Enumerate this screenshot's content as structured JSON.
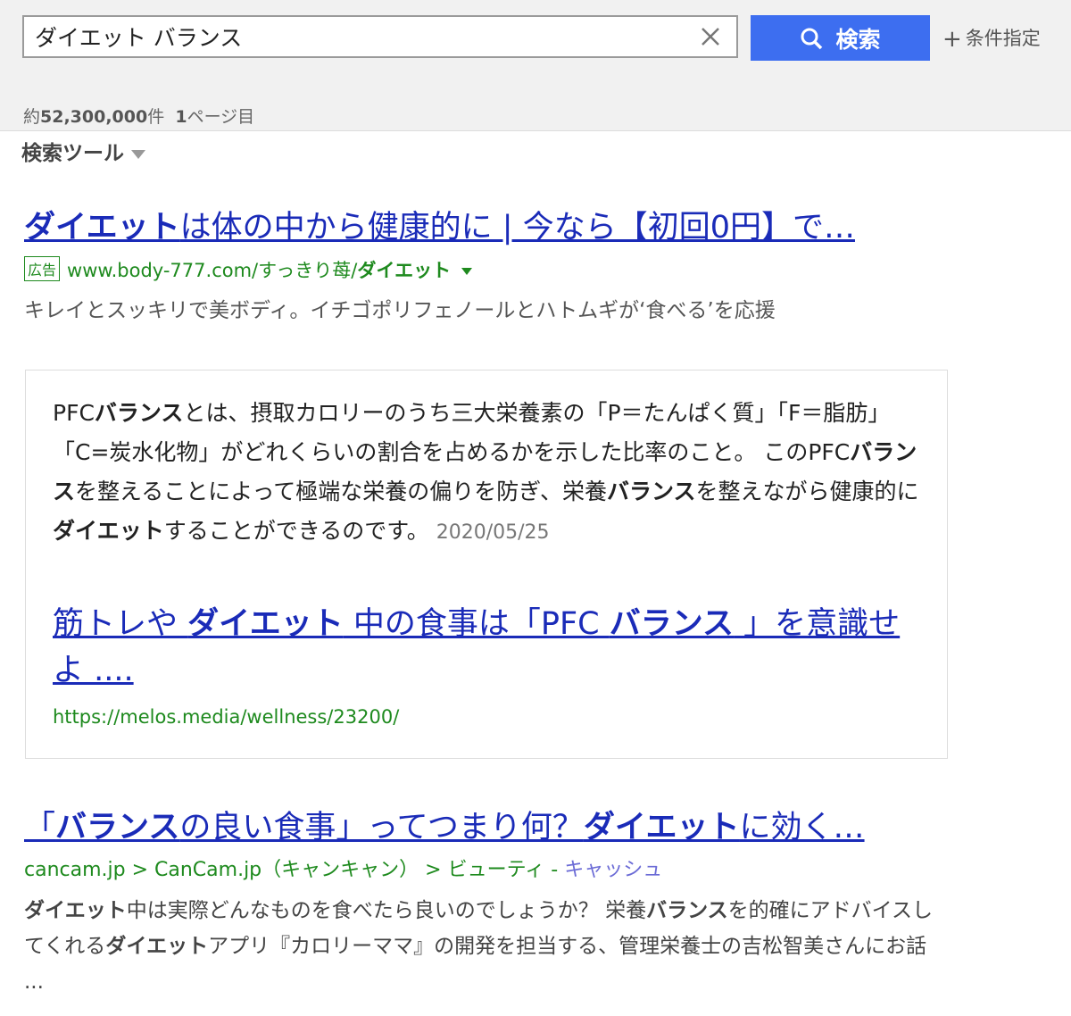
{
  "search": {
    "query": "ダイエット バランス",
    "button_label": "検索",
    "condition_label": "条件指定"
  },
  "stats": {
    "prefix": "約",
    "count": "52,300,000",
    "suffix": "件",
    "page_number": "1",
    "page_suffix": "ページ目"
  },
  "tools": {
    "label": "検索ツール"
  },
  "ad": {
    "title_parts": [
      "ダイエット",
      "は体の中から健康的に | 今なら【初回0円】で…"
    ],
    "badge": "広告",
    "url_prefix": "www.body-777.com/すっきり苺/",
    "url_bold": "ダイエット",
    "description": "キレイとスッキリで美ボディ。イチゴポリフェノールとハトムギが‘食べる’を応援"
  },
  "featured": {
    "text_parts": [
      "PFC",
      "バランス",
      "とは、摂取カロリーのうち三大栄養素の「P＝たんぱく質」「F＝脂肪」「C=炭水化物」がどれくらいの割合を占めるかを示した比率のこと。 このPFC",
      "バランス",
      "を整えることによって極端な栄養の偏りを防ぎ、栄養",
      "バランス",
      "を整えながら健康的に",
      "ダイエット",
      "することができるのです。"
    ],
    "date": "2020/05/25",
    "link_parts": [
      "筋トレや ",
      "ダイエット",
      " 中の食事は「PFC ",
      "バランス",
      " 」を意識せよ ...."
    ],
    "url": "https://melos.media/wellness/23200/"
  },
  "result2": {
    "title_parts": [
      "「",
      "バランス",
      "の良い食事」ってつまり何？",
      "ダイエット",
      "に効く…"
    ],
    "breadcrumb": "cancam.jp > CanCam.jp（キャンキャン） > ビューティ",
    "cache_label": "キャッシュ",
    "desc_parts": [
      "ダイエット",
      "中は実際どんなものを食べたら良いのでしょうか？ 栄養",
      "バランス",
      "を的確にアドバイスしてくれる",
      "ダイエット",
      "アプリ『カロリーママ』の開発を担当する、管理栄養士の吉松智美さんにお話 ..."
    ]
  },
  "colors": {
    "link": "#1a2bb8",
    "url_green": "#1e8a1e",
    "search_button": "#3d6ef0"
  },
  "icons": [
    "close-icon",
    "search-icon",
    "plus-icon",
    "caret-down-icon"
  ]
}
